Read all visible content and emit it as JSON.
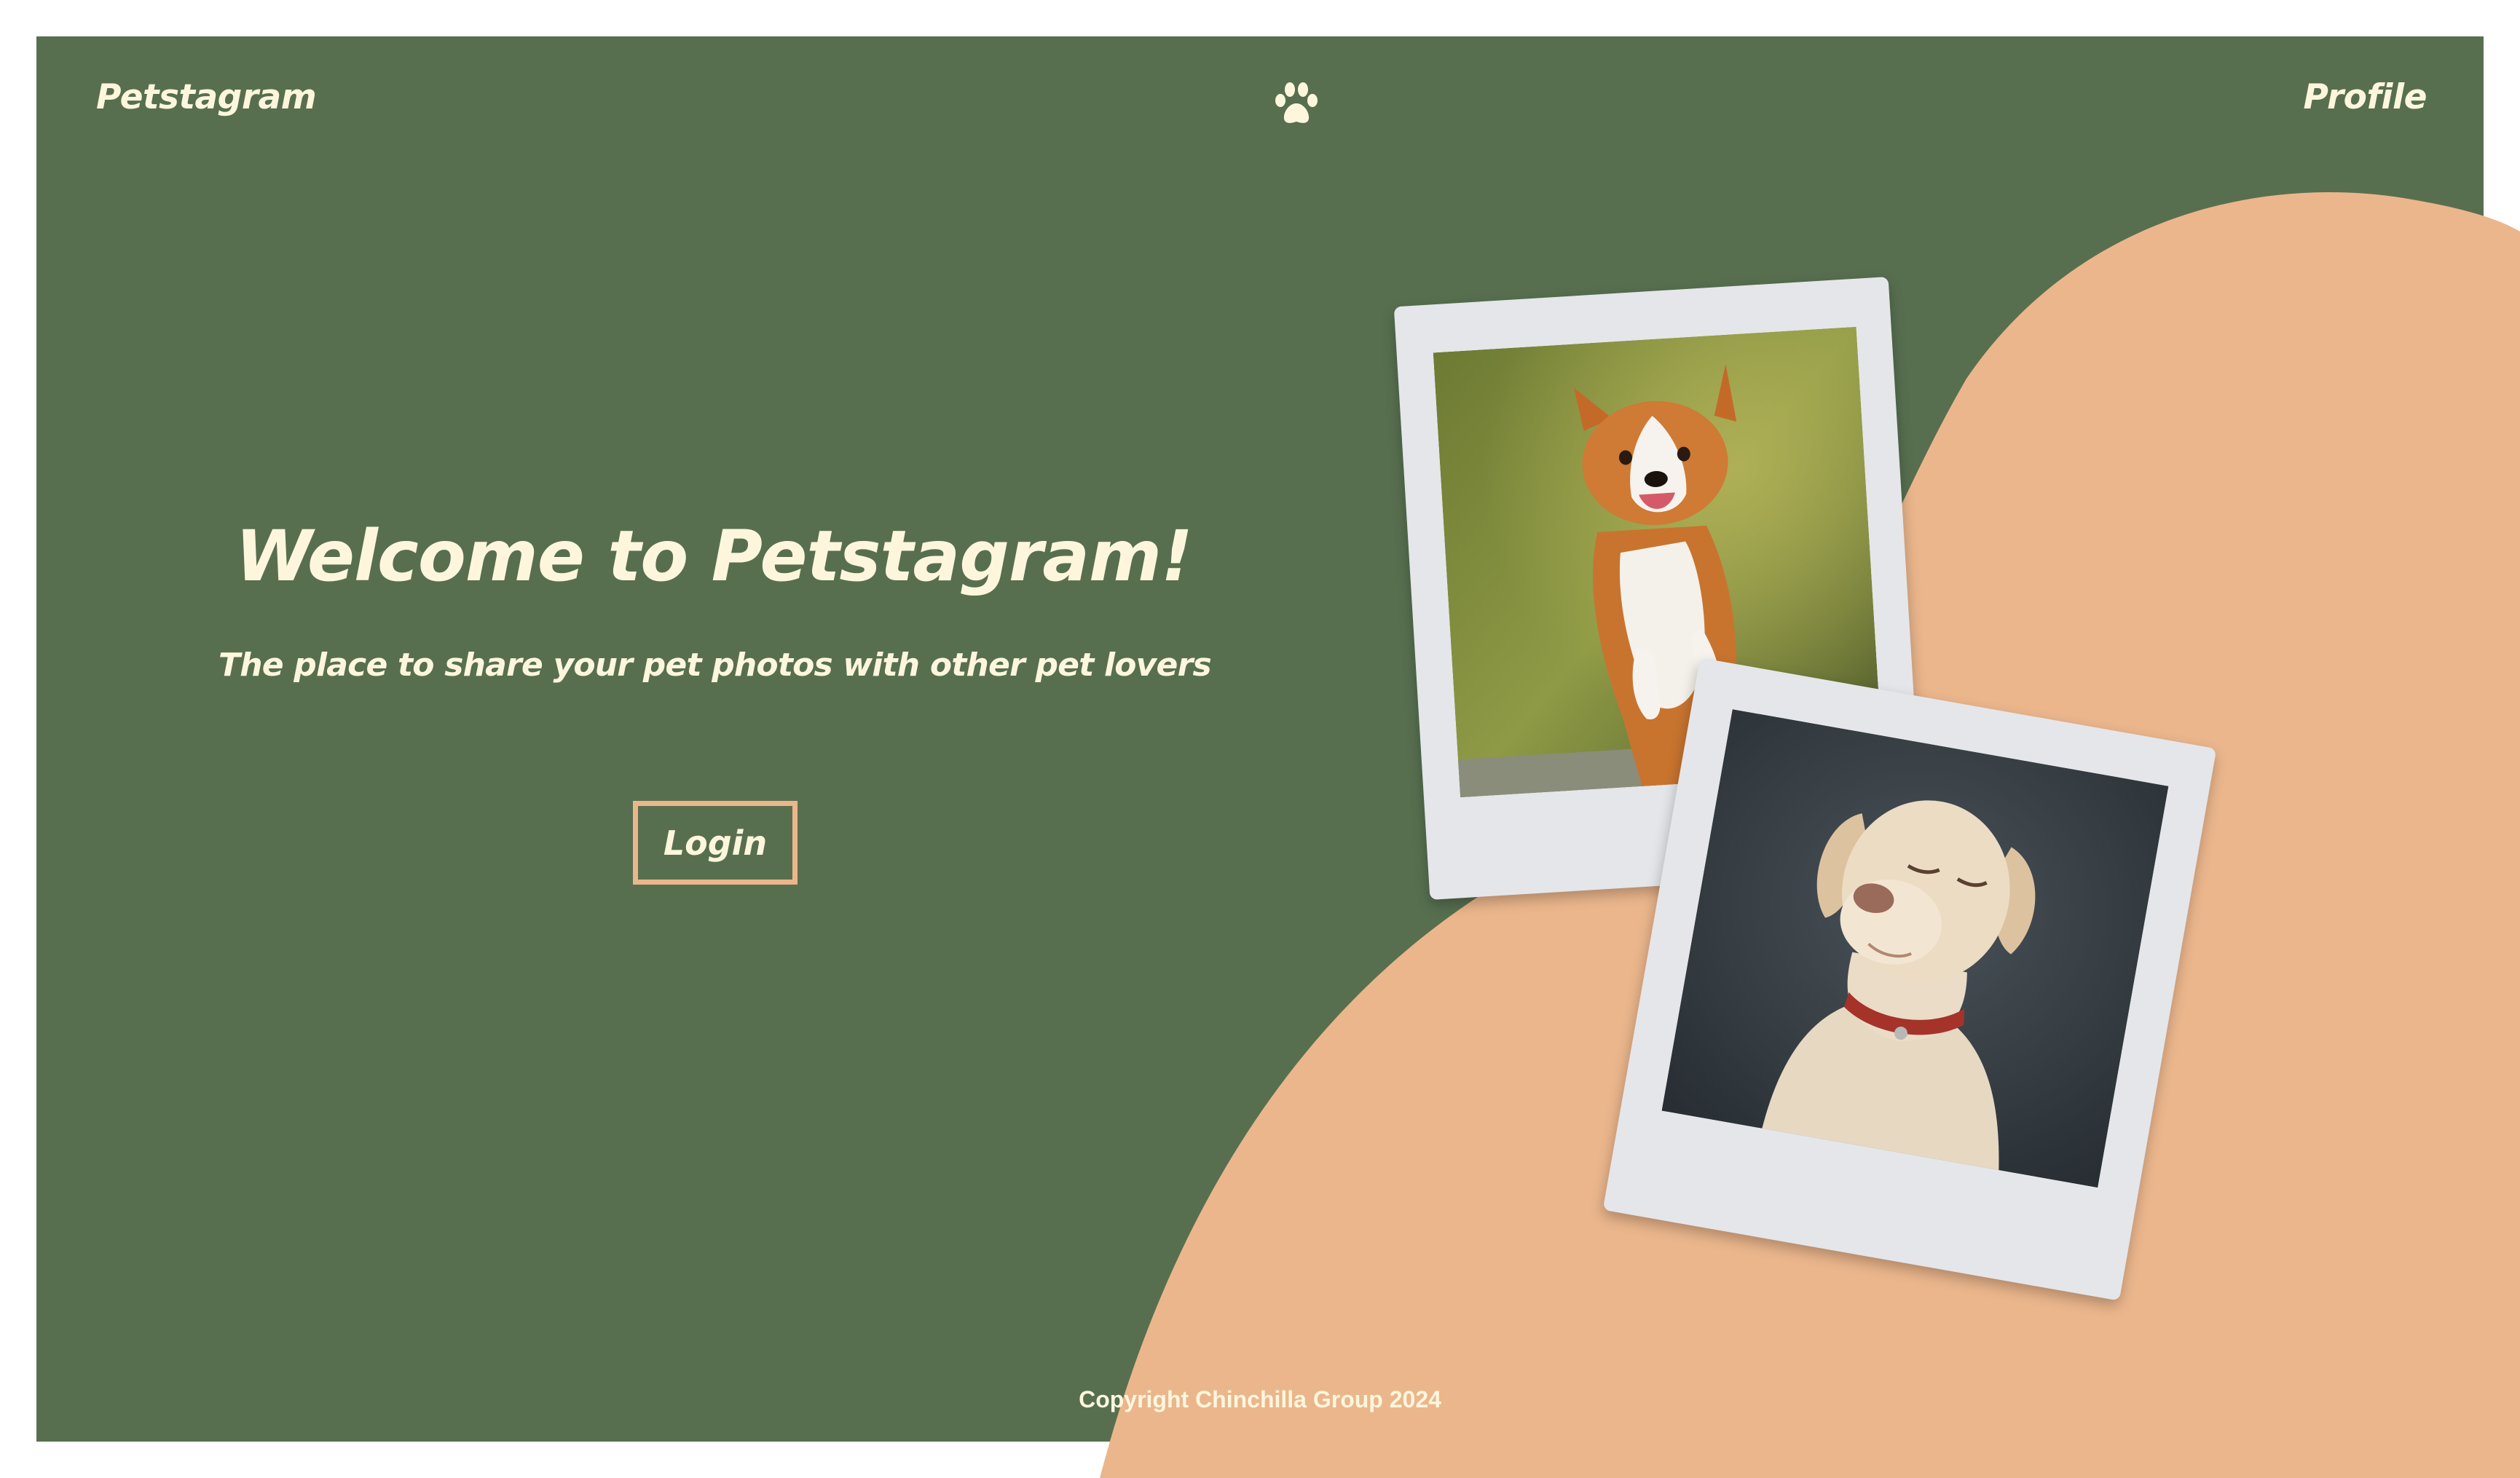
{
  "header": {
    "brand": "Petstagram",
    "logo_icon": "paw-icon",
    "profile_link": "Profile"
  },
  "hero": {
    "title": "Welcome to Petstagram!",
    "subtitle": "The place to share your pet photos with other pet lovers",
    "login_button": "Login"
  },
  "gallery": {
    "photos": [
      {
        "name": "corgi-photo",
        "subject": "corgi"
      },
      {
        "name": "labrador-photo",
        "subject": "labrador"
      }
    ]
  },
  "footer": {
    "copyright": "Copyright Chinchilla Group 2024"
  },
  "colors": {
    "background_green": "#576f4f",
    "accent_peach": "#ebb68c",
    "text_cream": "#fdf6dd",
    "polaroid_frame": "#e4e6ea"
  }
}
